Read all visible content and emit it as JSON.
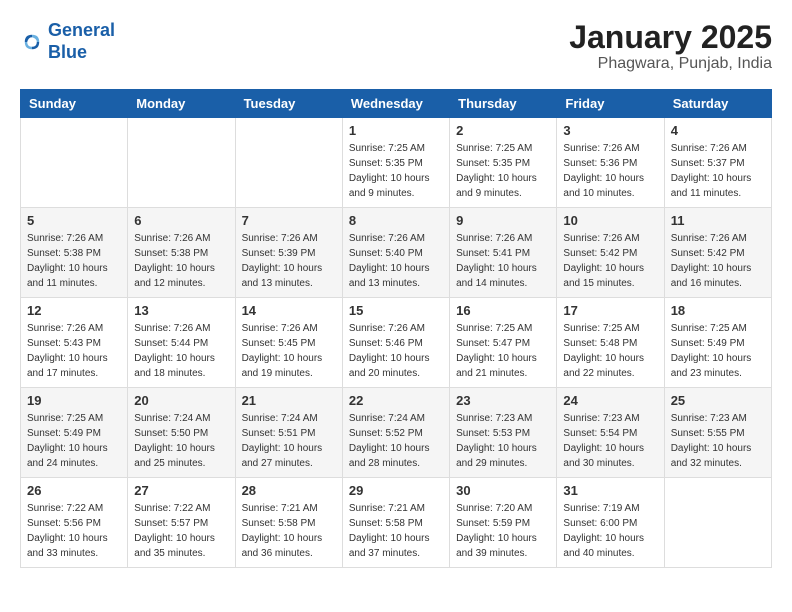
{
  "header": {
    "logo_line1": "General",
    "logo_line2": "Blue",
    "month": "January 2025",
    "location": "Phagwara, Punjab, India"
  },
  "weekdays": [
    "Sunday",
    "Monday",
    "Tuesday",
    "Wednesday",
    "Thursday",
    "Friday",
    "Saturday"
  ],
  "weeks": [
    [
      {
        "day": "",
        "info": ""
      },
      {
        "day": "",
        "info": ""
      },
      {
        "day": "",
        "info": ""
      },
      {
        "day": "1",
        "info": "Sunrise: 7:25 AM\nSunset: 5:35 PM\nDaylight: 10 hours\nand 9 minutes."
      },
      {
        "day": "2",
        "info": "Sunrise: 7:25 AM\nSunset: 5:35 PM\nDaylight: 10 hours\nand 9 minutes."
      },
      {
        "day": "3",
        "info": "Sunrise: 7:26 AM\nSunset: 5:36 PM\nDaylight: 10 hours\nand 10 minutes."
      },
      {
        "day": "4",
        "info": "Sunrise: 7:26 AM\nSunset: 5:37 PM\nDaylight: 10 hours\nand 11 minutes."
      }
    ],
    [
      {
        "day": "5",
        "info": "Sunrise: 7:26 AM\nSunset: 5:38 PM\nDaylight: 10 hours\nand 11 minutes."
      },
      {
        "day": "6",
        "info": "Sunrise: 7:26 AM\nSunset: 5:38 PM\nDaylight: 10 hours\nand 12 minutes."
      },
      {
        "day": "7",
        "info": "Sunrise: 7:26 AM\nSunset: 5:39 PM\nDaylight: 10 hours\nand 13 minutes."
      },
      {
        "day": "8",
        "info": "Sunrise: 7:26 AM\nSunset: 5:40 PM\nDaylight: 10 hours\nand 13 minutes."
      },
      {
        "day": "9",
        "info": "Sunrise: 7:26 AM\nSunset: 5:41 PM\nDaylight: 10 hours\nand 14 minutes."
      },
      {
        "day": "10",
        "info": "Sunrise: 7:26 AM\nSunset: 5:42 PM\nDaylight: 10 hours\nand 15 minutes."
      },
      {
        "day": "11",
        "info": "Sunrise: 7:26 AM\nSunset: 5:42 PM\nDaylight: 10 hours\nand 16 minutes."
      }
    ],
    [
      {
        "day": "12",
        "info": "Sunrise: 7:26 AM\nSunset: 5:43 PM\nDaylight: 10 hours\nand 17 minutes."
      },
      {
        "day": "13",
        "info": "Sunrise: 7:26 AM\nSunset: 5:44 PM\nDaylight: 10 hours\nand 18 minutes."
      },
      {
        "day": "14",
        "info": "Sunrise: 7:26 AM\nSunset: 5:45 PM\nDaylight: 10 hours\nand 19 minutes."
      },
      {
        "day": "15",
        "info": "Sunrise: 7:26 AM\nSunset: 5:46 PM\nDaylight: 10 hours\nand 20 minutes."
      },
      {
        "day": "16",
        "info": "Sunrise: 7:25 AM\nSunset: 5:47 PM\nDaylight: 10 hours\nand 21 minutes."
      },
      {
        "day": "17",
        "info": "Sunrise: 7:25 AM\nSunset: 5:48 PM\nDaylight: 10 hours\nand 22 minutes."
      },
      {
        "day": "18",
        "info": "Sunrise: 7:25 AM\nSunset: 5:49 PM\nDaylight: 10 hours\nand 23 minutes."
      }
    ],
    [
      {
        "day": "19",
        "info": "Sunrise: 7:25 AM\nSunset: 5:49 PM\nDaylight: 10 hours\nand 24 minutes."
      },
      {
        "day": "20",
        "info": "Sunrise: 7:24 AM\nSunset: 5:50 PM\nDaylight: 10 hours\nand 25 minutes."
      },
      {
        "day": "21",
        "info": "Sunrise: 7:24 AM\nSunset: 5:51 PM\nDaylight: 10 hours\nand 27 minutes."
      },
      {
        "day": "22",
        "info": "Sunrise: 7:24 AM\nSunset: 5:52 PM\nDaylight: 10 hours\nand 28 minutes."
      },
      {
        "day": "23",
        "info": "Sunrise: 7:23 AM\nSunset: 5:53 PM\nDaylight: 10 hours\nand 29 minutes."
      },
      {
        "day": "24",
        "info": "Sunrise: 7:23 AM\nSunset: 5:54 PM\nDaylight: 10 hours\nand 30 minutes."
      },
      {
        "day": "25",
        "info": "Sunrise: 7:23 AM\nSunset: 5:55 PM\nDaylight: 10 hours\nand 32 minutes."
      }
    ],
    [
      {
        "day": "26",
        "info": "Sunrise: 7:22 AM\nSunset: 5:56 PM\nDaylight: 10 hours\nand 33 minutes."
      },
      {
        "day": "27",
        "info": "Sunrise: 7:22 AM\nSunset: 5:57 PM\nDaylight: 10 hours\nand 35 minutes."
      },
      {
        "day": "28",
        "info": "Sunrise: 7:21 AM\nSunset: 5:58 PM\nDaylight: 10 hours\nand 36 minutes."
      },
      {
        "day": "29",
        "info": "Sunrise: 7:21 AM\nSunset: 5:58 PM\nDaylight: 10 hours\nand 37 minutes."
      },
      {
        "day": "30",
        "info": "Sunrise: 7:20 AM\nSunset: 5:59 PM\nDaylight: 10 hours\nand 39 minutes."
      },
      {
        "day": "31",
        "info": "Sunrise: 7:19 AM\nSunset: 6:00 PM\nDaylight: 10 hours\nand 40 minutes."
      },
      {
        "day": "",
        "info": ""
      }
    ]
  ]
}
